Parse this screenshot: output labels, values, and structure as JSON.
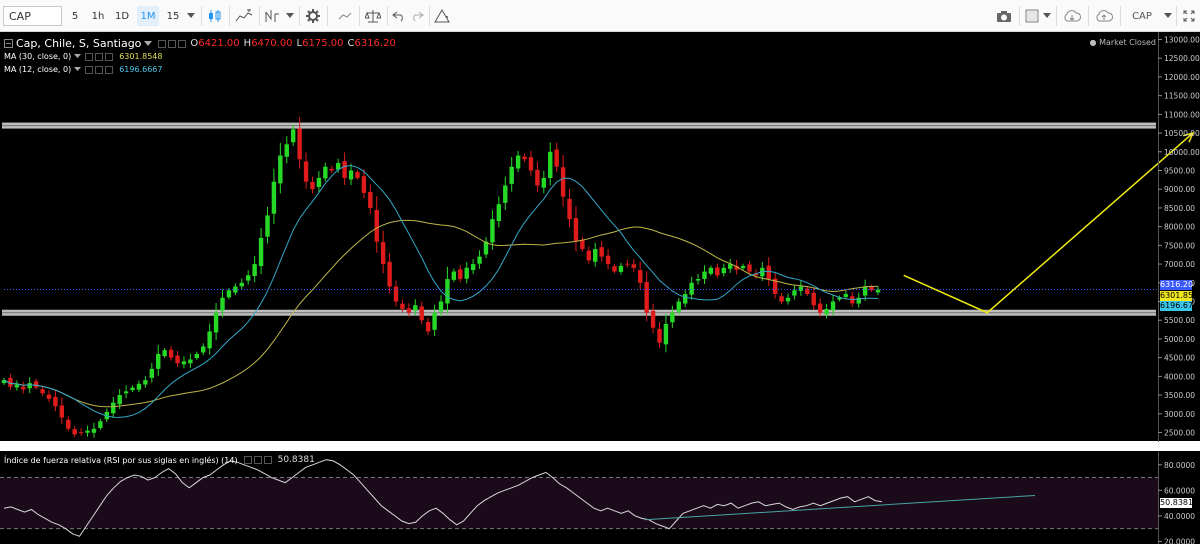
{
  "toolbar": {
    "symbol": "CAP",
    "intervals": [
      "5",
      "1h",
      "1D",
      "1M",
      "15"
    ],
    "active_interval": "1M",
    "compare_symbol": "CAP",
    "icons": [
      "candles-icon",
      "area-chart-icon",
      "indicators-icon",
      "gear-icon",
      "balance-icon",
      "undo-icon",
      "redo-icon",
      "alert-icon",
      "camera-icon",
      "square-icon",
      "cloud-load-icon",
      "cloud-save-icon",
      "fullscreen-icon"
    ]
  },
  "legend": {
    "title": "Cap, Chile, S, Santiago",
    "o_label": "O",
    "o_value": "6421.00",
    "h_label": "H",
    "h_value": "6470.00",
    "l_label": "L",
    "l_value": "6175.00",
    "c_label": "C",
    "c_value": "6316.20",
    "ma30_label": "MA (30, close, 0)",
    "ma30_value": "6301.8548",
    "ma12_label": "MA (12, close, 0)",
    "ma12_value": "6196.6667",
    "status": "Market Closed",
    "rsi_label": "Índice de fuerza relativa (RSI por sus siglas en inglés) (14)",
    "rsi_value": "50.8381"
  },
  "colors": {
    "up": "#26d926",
    "down": "#e01b1b",
    "ma30": "#bfb84a",
    "ma12": "#35a8c8",
    "arrow": "#f0ea0f",
    "band": "#bdbdbd",
    "last_price": "#3d5afe",
    "rsi_line": "#d9d9d9",
    "rsi_trend": "#4aa3a3"
  },
  "chart_data": [
    {
      "type": "candlestick",
      "title": "Cap, Chile, S, Santiago",
      "ylim": [
        2300,
        13200
      ],
      "y_ticks": [
        2500,
        3000,
        3500,
        4000,
        4500,
        5000,
        5500,
        6000,
        6500,
        7000,
        7500,
        8000,
        8500,
        9000,
        9500,
        10000,
        10500,
        11000,
        11500,
        12000,
        12500,
        13000
      ],
      "y_tick_labels": [
        "2500.00",
        "3000.00",
        "3500.00",
        "4000.00",
        "4500.00",
        "5000.00",
        "5500.00",
        "6000.00",
        "6500.00",
        "7000.00",
        "7500.00",
        "8000.00",
        "8500.00",
        "9000.00",
        "9500.00",
        "10000.00",
        "10500.00",
        "11000.00",
        "11500.00",
        "12000.00",
        "12500.00",
        "13000.00"
      ],
      "last_price_labels": [
        "6316.20",
        "6301.85",
        "6196.67"
      ],
      "close_path": [
        3900,
        3720,
        3780,
        3650,
        3820,
        3700,
        3550,
        3400,
        3200,
        2900,
        2600,
        2450,
        2500,
        2550,
        2600,
        2800,
        3050,
        3300,
        3500,
        3600,
        3700,
        3800,
        3900,
        4200,
        4600,
        4700,
        4500,
        4350,
        4400,
        4450,
        4600,
        4800,
        5200,
        5700,
        6100,
        6300,
        6400,
        6500,
        6700,
        7000,
        7700,
        8300,
        9200,
        9900,
        10200,
        10600,
        9800,
        9200,
        9000,
        9300,
        9600,
        9500,
        9700,
        9300,
        9500,
        9300,
        8900,
        8500,
        7600,
        7000,
        6400,
        6000,
        5800,
        5700,
        5900,
        5500,
        5200,
        5700,
        6000,
        6600,
        6800,
        6600,
        6900,
        7000,
        7200,
        7600,
        8200,
        8600,
        9100,
        9600,
        9900,
        9800,
        9500,
        9100,
        9300,
        10000,
        9600,
        8800,
        8200,
        7600,
        7400,
        7100,
        7400,
        7200,
        7000,
        6800,
        6950,
        7000,
        6900,
        6500,
        5700,
        5300,
        4900,
        5400,
        5700,
        6000,
        6200,
        6500,
        6600,
        6800,
        6900,
        6700,
        6900,
        7000,
        6850,
        6950,
        6800,
        6700,
        6900,
        6600,
        6200,
        6000,
        6100,
        6300,
        6400,
        6200,
        5900,
        5700,
        5800,
        6000,
        6100,
        6200,
        5950,
        6100,
        6400,
        6300,
        6320
      ],
      "annotations": [
        {
          "type": "horizontal_band",
          "y": 10700
        },
        {
          "type": "horizontal_band",
          "y": 5700
        },
        {
          "type": "arrow_path",
          "points": [
            [
              140,
              6700
            ],
            [
              153,
              5700
            ],
            [
              185,
              10500
            ]
          ]
        }
      ]
    },
    {
      "type": "line",
      "title": "Índice de fuerza relativa (RSI por sus siglas en inglés) (14)",
      "ylim": [
        18,
        90
      ],
      "y_tick_labels": [
        "80.0000",
        "60.0000",
        "40.0000",
        "20.0000"
      ],
      "y_ticks": [
        80,
        60,
        40,
        20
      ],
      "bands": [
        70,
        30
      ],
      "value_label": "50.8381",
      "values": [
        46,
        47,
        45,
        43,
        45,
        41,
        38,
        35,
        33,
        30,
        26,
        24,
        32,
        40,
        48,
        56,
        62,
        67,
        70,
        72,
        71,
        68,
        70,
        74,
        77,
        73,
        66,
        62,
        66,
        70,
        72,
        76,
        80,
        83,
        82,
        80,
        78,
        76,
        73,
        70,
        68,
        66,
        70,
        74,
        78,
        80,
        82,
        84,
        83,
        80,
        76,
        72,
        66,
        60,
        54,
        48,
        44,
        40,
        36,
        34,
        35,
        40,
        44,
        46,
        42,
        37,
        33,
        36,
        42,
        48,
        52,
        55,
        58,
        60,
        62,
        64,
        67,
        70,
        72,
        74,
        70,
        65,
        62,
        58,
        54,
        50,
        46,
        44,
        46,
        44,
        42,
        44,
        40,
        38,
        37,
        34,
        32,
        30,
        36,
        42,
        44,
        46,
        48,
        46,
        49,
        48,
        50,
        46,
        48,
        50,
        51,
        48,
        49,
        50,
        47,
        45,
        47,
        48,
        50,
        48,
        50,
        52,
        54,
        55,
        51,
        53,
        55,
        52,
        51
      ]
    }
  ]
}
